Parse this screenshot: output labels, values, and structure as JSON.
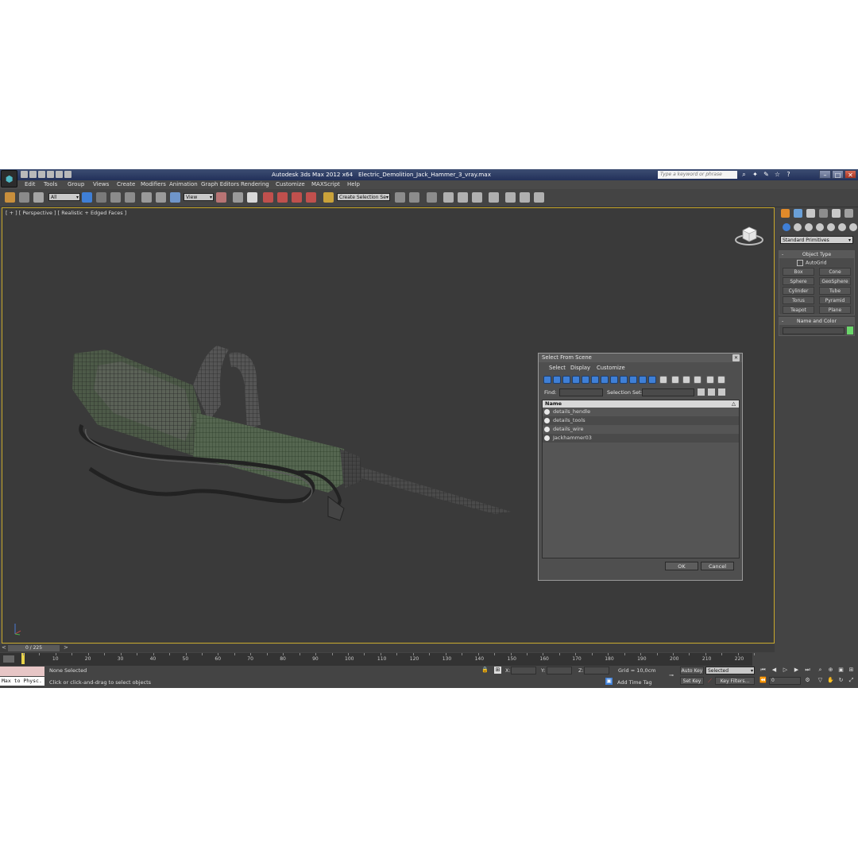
{
  "titlebar": {
    "app_name": "Autodesk 3ds Max  2012 x64",
    "file_name": "Electric_Demolition_Jack_Hammer_3_vray.max",
    "search_placeholder": "Type a keyword or phrase"
  },
  "menu": [
    "Edit",
    "Tools",
    "Group",
    "Views",
    "Create",
    "Modifiers",
    "Animation",
    "Graph Editors",
    "Rendering",
    "Customize",
    "MAXScript",
    "Help"
  ],
  "toolbar": {
    "selection_filter": "All",
    "reference_coord": "View",
    "named_selection_set": "Create Selection Se"
  },
  "viewport": {
    "label": "[ + ] [ Perspective ] [ Realistic + Edged Faces ]"
  },
  "dialog": {
    "title": "Select From Scene",
    "close_glyph": "✕",
    "menu": [
      "Select",
      "Display",
      "Customize"
    ],
    "find_label": "Find:",
    "selection_set_label": "Selection Set:",
    "column_name": "Name",
    "sort_glyph": "△",
    "items": [
      "details_hendle",
      "details_tools",
      "details_wire",
      "Jackhammer03"
    ],
    "ok": "OK",
    "cancel": "Cancel"
  },
  "command_panel": {
    "dropdown": "Standard Primitives",
    "object_type_title": "Object Type",
    "autogrid": "AutoGrid",
    "buttons": [
      "Box",
      "Cone",
      "Sphere",
      "GeoSphere",
      "Cylinder",
      "Tube",
      "Torus",
      "Pyramid",
      "Teapot",
      "Plane"
    ],
    "name_color_title": "Name and Color",
    "object_color": "#6bd66b",
    "rollout_sign": "-"
  },
  "timeline": {
    "frame_label": "0 / 225",
    "ticks": [
      "10",
      "20",
      "30",
      "40",
      "50",
      "60",
      "70",
      "80",
      "90",
      "100",
      "110",
      "120",
      "130",
      "140",
      "150",
      "160",
      "170",
      "180",
      "190",
      "200",
      "210",
      "220"
    ]
  },
  "status": {
    "selection": "None Selected",
    "prompt": "Click or click-and-drag to select objects",
    "x_label": "X:",
    "y_label": "Y:",
    "z_label": "Z:",
    "grid": "Grid = 10,0cm",
    "add_time_tag": "Add Time Tag",
    "auto_key": "Auto Key",
    "set_key": "Set Key",
    "key_mode": "Selected",
    "key_filters": "Key Filters...",
    "maxscript_listener": "Max to Physc.",
    "frame_value": "0"
  }
}
